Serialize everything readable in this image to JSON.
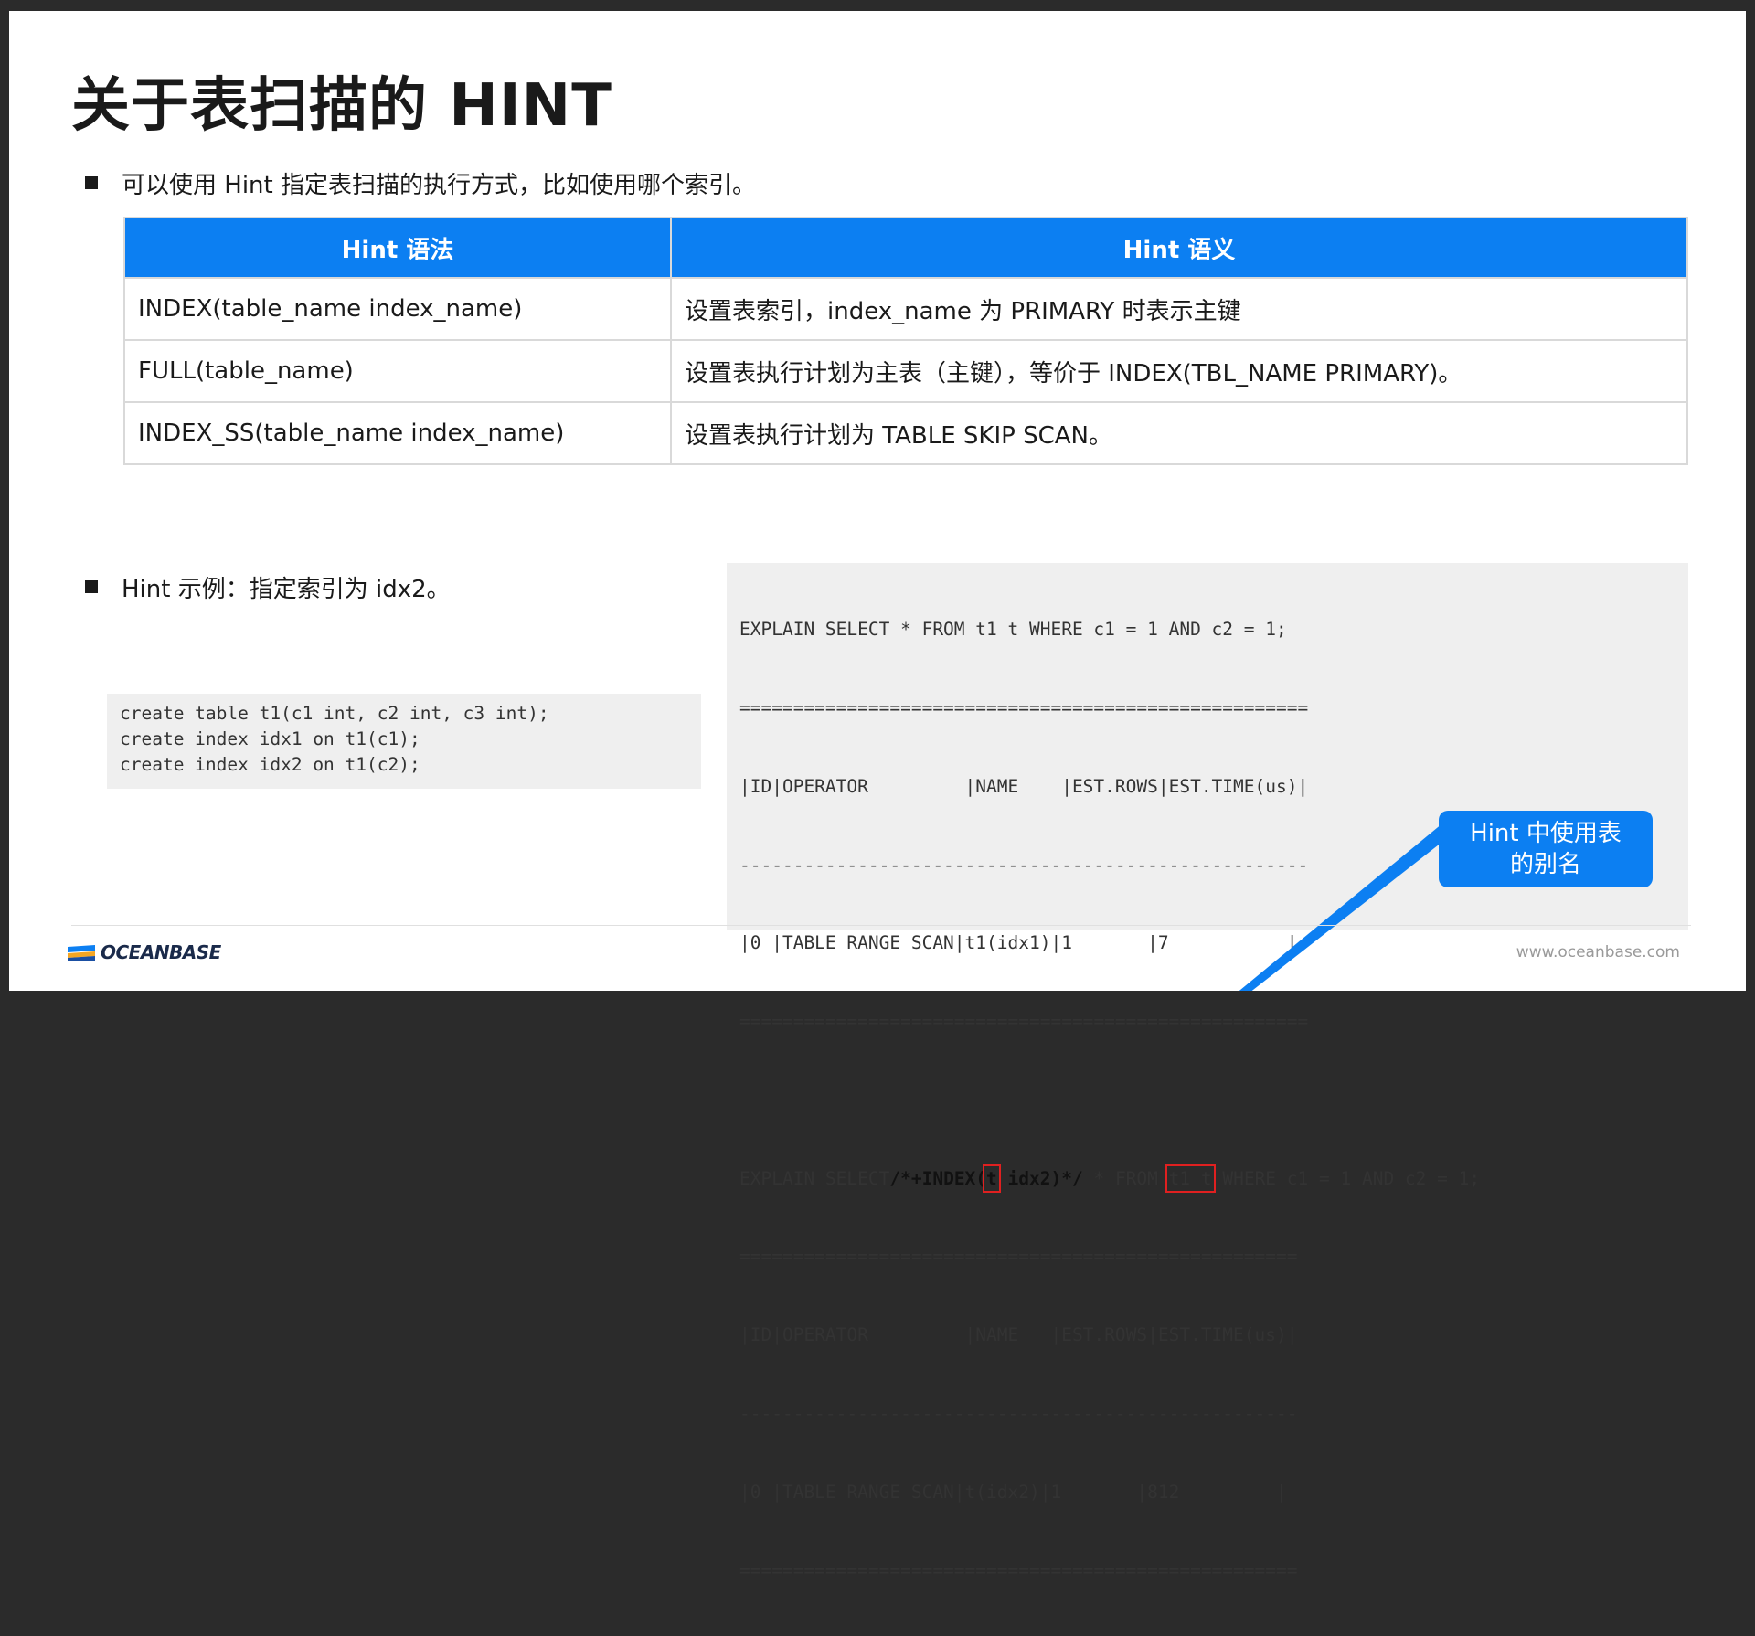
{
  "title": "关于表扫描的 HINT",
  "bullet1": "可以使用 Hint 指定表扫描的执行方式，比如使用哪个索引。",
  "table": {
    "headers": [
      "Hint 语法",
      "Hint 语义"
    ],
    "rows": [
      [
        "INDEX(table_name index_name)",
        "设置表索引，index_name 为 PRIMARY 时表示主键"
      ],
      [
        "FULL(table_name)",
        "设置表执行计划为主表（主键），等价于 INDEX(TBL_NAME PRIMARY)。"
      ],
      [
        "INDEX_SS(table_name index_name)",
        "设置表执行计划为 TABLE SKIP SCAN。"
      ]
    ]
  },
  "bullet2": "Hint 示例：指定索引为 idx2。",
  "create_sql": [
    "create table t1(c1 int, c2 int, c3 int);",
    "create index idx1 on t1(c1);",
    "create index idx2 on t1(c2);"
  ],
  "explain1": {
    "query": "EXPLAIN SELECT * FROM t1 t WHERE c1 = 1 AND c2 = 1;",
    "sep_eq": "=====================================================",
    "header": "|ID|OPERATOR         |NAME    |EST.ROWS|EST.TIME(us)|",
    "sep_dash": "-----------------------------------------------------",
    "row": "|0 |TABLE RANGE SCAN|t1(idx1)|1       |7           |",
    "sep_eq2": "====================================================="
  },
  "explain2": {
    "q_prefix": "EXPLAIN SELECT",
    "q_hint_open": "/*+INDEX(",
    "q_alias": "t",
    "q_hint_close": " idx2)*/",
    "q_mid": " * FROM ",
    "q_table": "t1 t",
    "q_suffix": " WHERE c1 = 1 AND c2 = 1;",
    "sep_eq": "====================================================",
    "header": "|ID|OPERATOR         |NAME   |EST.ROWS|EST.TIME(us)|",
    "sep_dash": "----------------------------------------------------",
    "row": "|0 |TABLE RANGE SCAN|t(idx2)|1       |812         |",
    "sep_eq2": "===================================================="
  },
  "callout": [
    "Hint 中使用表",
    "的别名"
  ],
  "footer": {
    "logo_text": "OCEANBASE",
    "website": "www.oceanbase.com"
  },
  "colors": {
    "header_blue": "#0c7ff2",
    "highlight_red": "#e02020",
    "code_bg": "#efefef"
  }
}
